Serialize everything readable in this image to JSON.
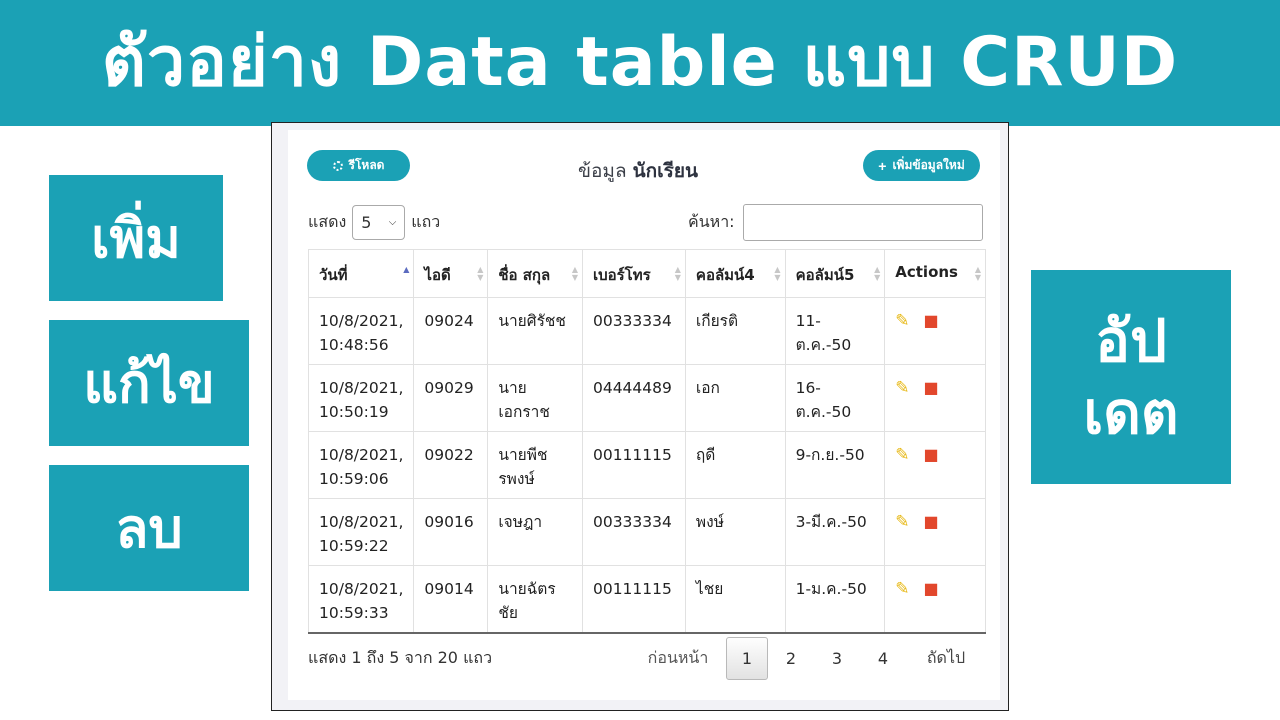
{
  "banner": {
    "title": "ตัวอย่าง Data table แบบ CRUD"
  },
  "side": {
    "add": "เพิ่ม",
    "edit": "แก้ไข",
    "delete": "ลบ",
    "update_1": "อัป",
    "update_2": "เดต"
  },
  "toolbar": {
    "reload_label": "รีโหลด",
    "add_label": "เพิ่มข้อมูลใหม่",
    "title_prefix": "ข้อมูล",
    "title_main": "นักเรียน"
  },
  "length": {
    "show": "แสดง",
    "value": "5",
    "rows": "แถว"
  },
  "search": {
    "label": "ค้นหา:",
    "value": ""
  },
  "table": {
    "headers": [
      "วันที่",
      "ไอดี",
      "ชื่อ สกุล",
      "เบอร์โทร",
      "คอลัมน์4",
      "คอลัมน์5",
      "Actions"
    ],
    "rows": [
      {
        "date": "10/8/2021,",
        "time": "10:48:56",
        "id": "09024",
        "name1": "นายศิรัชช",
        "name2": "",
        "phone": "00333334",
        "c4": "เกียรติ",
        "c5": "11-ต.ค.-50"
      },
      {
        "date": "10/8/2021,",
        "time": "10:50:19",
        "id": "09029",
        "name1": "นาย",
        "name2": "เอกราช",
        "phone": "04444489",
        "c4": "เอก",
        "c5": "16-ต.ค.-50"
      },
      {
        "date": "10/8/2021,",
        "time": "10:59:06",
        "id": "09022",
        "name1": "นายพีช",
        "name2": "รพงษ์",
        "phone": "00111115",
        "c4": "ฤดี",
        "c5": "9-ก.ย.-50"
      },
      {
        "date": "10/8/2021,",
        "time": "10:59:22",
        "id": "09016",
        "name1": "เจษฎา",
        "name2": "",
        "phone": "00333334",
        "c4": "พงษ์",
        "c5": "3-มี.ค.-50"
      },
      {
        "date": "10/8/2021,",
        "time": "10:59:33",
        "id": "09014",
        "name1": "นายฉัตร",
        "name2": "ชัย",
        "phone": "00111115",
        "c4": "ไชย",
        "c5": "1-ม.ค.-50"
      }
    ]
  },
  "footer": {
    "info": "แสดง 1 ถึง 5 จาก 20 แถว",
    "prev": "ก่อนหน้า",
    "pages": [
      "1",
      "2",
      "3",
      "4"
    ],
    "next": "ถัดไป"
  },
  "colors": {
    "accent": "#1ba1b5",
    "edit": "#e7b814",
    "delete": "#e2472c"
  },
  "icons": {
    "reload": "spinner-icon",
    "add": "plus-icon",
    "edit": "pencil-icon",
    "delete": "trash-icon"
  }
}
